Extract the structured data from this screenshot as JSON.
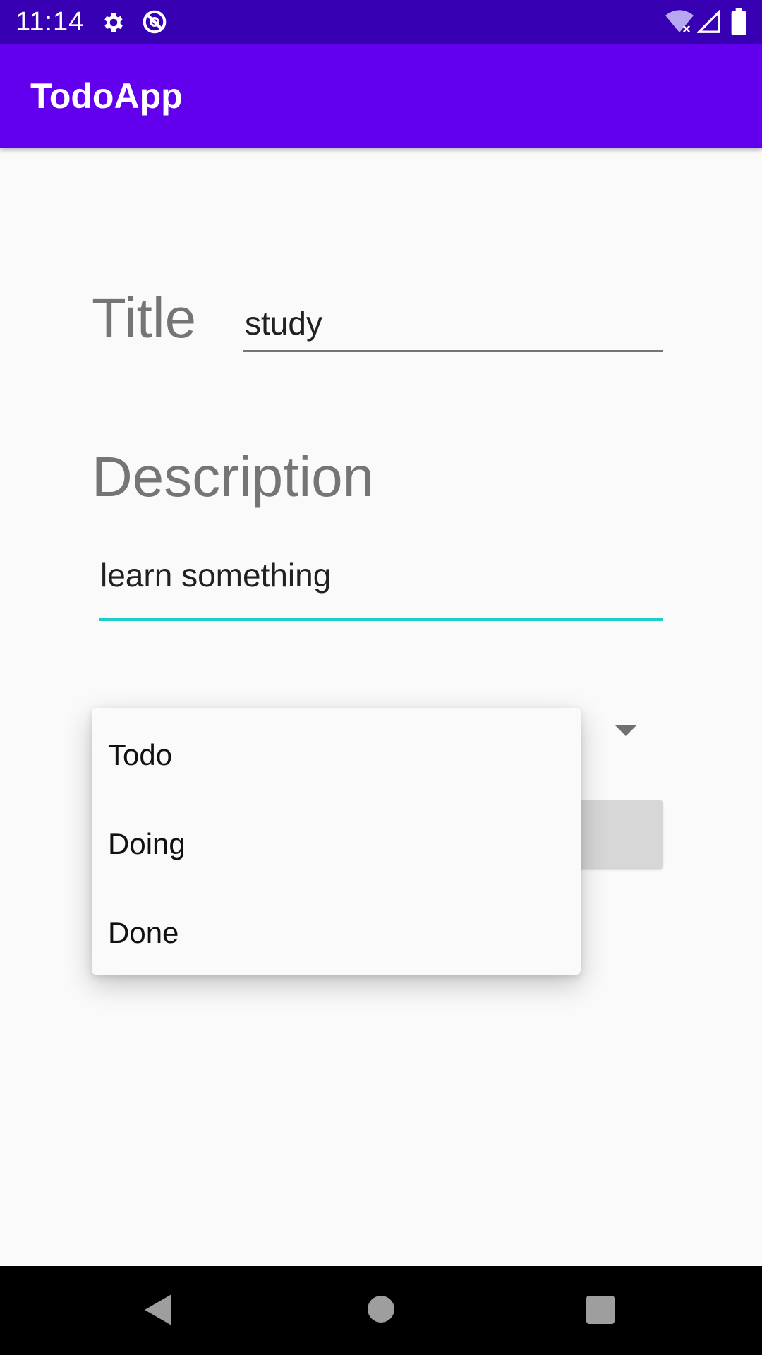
{
  "status_bar": {
    "time": "11:14",
    "icons": [
      "gear-icon",
      "no-disturb-icon",
      "wifi-icon",
      "signal-icon",
      "battery-icon"
    ]
  },
  "app_bar": {
    "title": "TodoApp"
  },
  "form": {
    "title_label": "Title",
    "title_value": "study",
    "description_label": "Description",
    "description_value": "learn something"
  },
  "status_dropdown": {
    "options": [
      "Todo",
      "Doing",
      "Done"
    ]
  },
  "colors": {
    "status_bar": "#3700b3",
    "app_bar": "#6200ee",
    "accent_underline": "#1ccfc9"
  },
  "nav_bar": {
    "icons": [
      "back-icon",
      "home-icon",
      "recents-icon"
    ]
  }
}
